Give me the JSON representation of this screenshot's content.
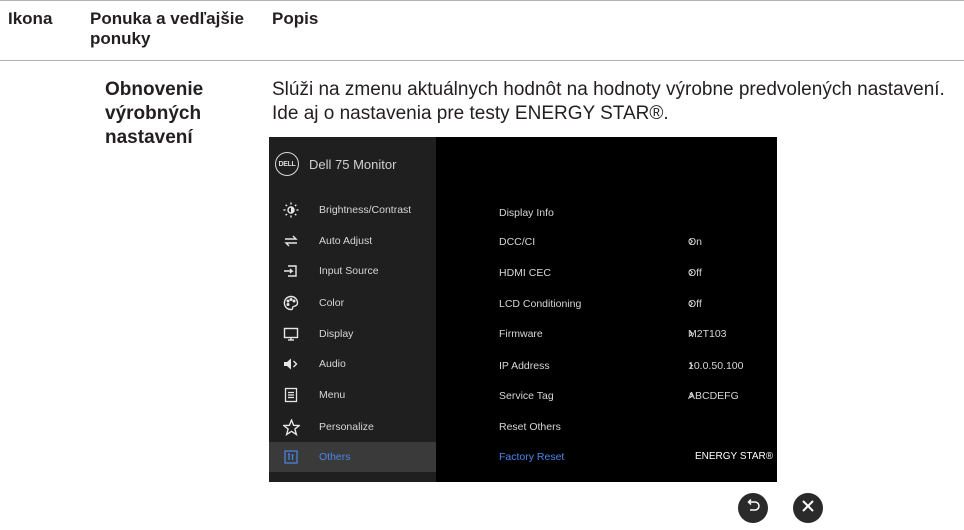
{
  "header": {
    "col_icon": "Ikona",
    "col_menu": "Ponuka a vedľajšie ponuky",
    "col_desc": "Popis"
  },
  "section": {
    "title": "Obnovenie výrobných nastavení",
    "description": "Slúži na zmenu aktuálnych hodnôt na hodnoty výrobne predvolených nastavení. Ide aj o nastavenia pre testy ENERGY STAR®."
  },
  "osd": {
    "brand": "DELL",
    "model": "Dell 75 Monitor",
    "menu": [
      {
        "label": "Brightness/Contrast",
        "icon": "brightness-icon"
      },
      {
        "label": "Auto Adjust",
        "icon": "auto-adjust-icon"
      },
      {
        "label": "Input Source",
        "icon": "input-source-icon"
      },
      {
        "label": "Color",
        "icon": "color-palette-icon"
      },
      {
        "label": "Display",
        "icon": "display-monitor-icon"
      },
      {
        "label": "Audio",
        "icon": "speaker-icon"
      },
      {
        "label": "Menu",
        "icon": "menu-list-icon"
      },
      {
        "label": "Personalize",
        "icon": "star-icon"
      },
      {
        "label": "Others",
        "icon": "others-icon",
        "active": true
      }
    ],
    "options": [
      {
        "label": "Display Info",
        "value": ""
      },
      {
        "label": "DCC/CI",
        "value": "On"
      },
      {
        "label": "HDMI CEC",
        "value": "Off"
      },
      {
        "label": "LCD Conditioning",
        "value": "Off"
      },
      {
        "label": "Firmware",
        "value": "M2T103"
      },
      {
        "label": "IP Address",
        "value": "10.0.50.100"
      },
      {
        "label": "Service Tag",
        "value": "ABCDEFG"
      },
      {
        "label": "Reset Others",
        "value": ""
      },
      {
        "label": "Factory Reset",
        "value": "ENERGY STAR®",
        "active": true
      }
    ],
    "active_color": "#4a86e8"
  },
  "buttons": {
    "back_icon": "back-icon",
    "close_icon": "close-icon"
  }
}
